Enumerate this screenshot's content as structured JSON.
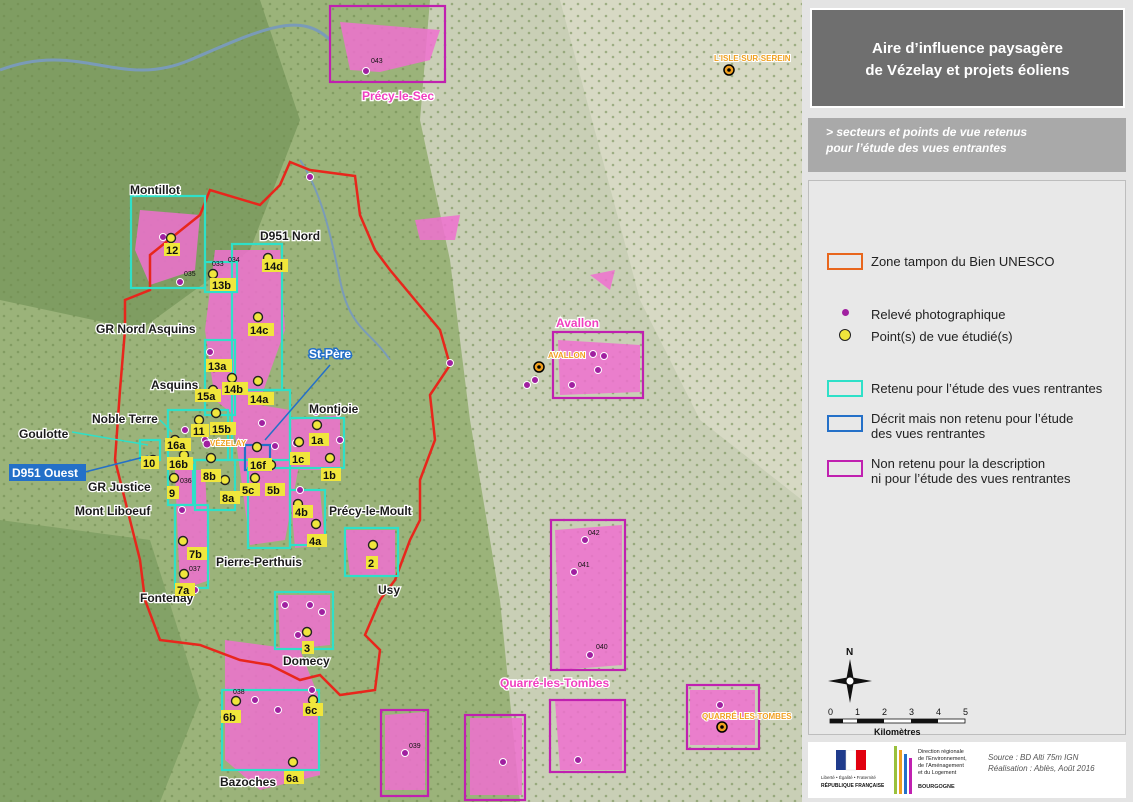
{
  "title": {
    "line1": "Aire d’influence paysagère",
    "line2": "de Vézelay et projets éoliens"
  },
  "subtitle": {
    "line1": "> secteurs et points de vue retenus",
    "line2": "pour l’étude des vues entrantes"
  },
  "legend": {
    "buffer": "Zone tampon du Bien UNESCO",
    "photo": "Relevé photographique",
    "viewpoint": "Point(s) de vue étudié(s)",
    "retained": "Retenu pour l’étude des vues rentrantes",
    "described_l1": "Décrit mais non retenu pour l’étude",
    "described_l2": "des vues rentrantes",
    "not_retained_l1": "Non retenu pour la description",
    "not_retained_l2": "ni pour l’étude des vues rentrantes"
  },
  "scale": {
    "north": "N",
    "ticks": [
      "0",
      "1",
      "2",
      "3",
      "4",
      "5"
    ],
    "unit": "Kilomètres"
  },
  "logos": {
    "republique": "RÉPUBLIQUE FRANÇAISE",
    "motto": "Liberté • Égalité • Fraternité",
    "dreal_l1": "Direction régionale",
    "dreal_l2": "de l’Environnement,",
    "dreal_l3": "de l’Aménagement",
    "dreal_l4": "et du Logement",
    "region": "BOURGOGNE"
  },
  "source": {
    "line1": "Source : BD Alti 75m IGN",
    "line2": "Réalisation : Ablès, Août 2016"
  },
  "colors": {
    "buffer": "#e8261c",
    "retained": "#2ee0c8",
    "described": "#2470c8",
    "not_retained": "#c020b0",
    "photo_point": "#a020a0",
    "viewpoint": "#f0e63c",
    "zone_fill": "#f070d0"
  },
  "map": {
    "places": {
      "precy_le_sec": "Précy-le-Sec",
      "isle_sur_serein": "L'ISLE-SUR-SEREIN",
      "avallon": "Avallon",
      "avallon_town": "AVALLON",
      "montillot": "Montillot",
      "d951_nord": "D951 Nord",
      "gr_nord_asquins": "GR Nord Asquins",
      "st_pere": "St-Père",
      "asquins": "Asquins",
      "montjoie": "Montjoie",
      "noble_terre": "Noble Terre",
      "goulotte": "Goulotte",
      "vezelay": "VÉZELAY",
      "d951_ouest": "D951 Ouest",
      "gr_justice": "GR Justice",
      "mont_liboeuf": "Mont Liboeuf",
      "precy_le_moult": "Précy-le-Moult",
      "pierre_perthuis": "Pierre-Perthuis",
      "fontenay": "Fontenay",
      "usy": "Usy",
      "domecy": "Domecy",
      "quarre_les_tombes": "Quarré-les-Tombes",
      "quarre_town": "QUARRÉ-LES-TOMBES",
      "bazoches": "Bazoches"
    },
    "viewpoints": [
      "12",
      "13b",
      "14d",
      "14c",
      "13a",
      "14b",
      "14a",
      "15a",
      "11",
      "15b",
      "16a",
      "16b",
      "16f",
      "1a",
      "1c",
      "1b",
      "10",
      "9",
      "8b",
      "8a",
      "5c",
      "5b",
      "4b",
      "4a",
      "7b",
      "7a",
      "2",
      "3",
      "6b",
      "6c",
      "6a"
    ],
    "photo_ids": [
      "043",
      "035",
      "033",
      "034",
      "036",
      "037",
      "042",
      "041",
      "040",
      "038",
      "039"
    ]
  }
}
